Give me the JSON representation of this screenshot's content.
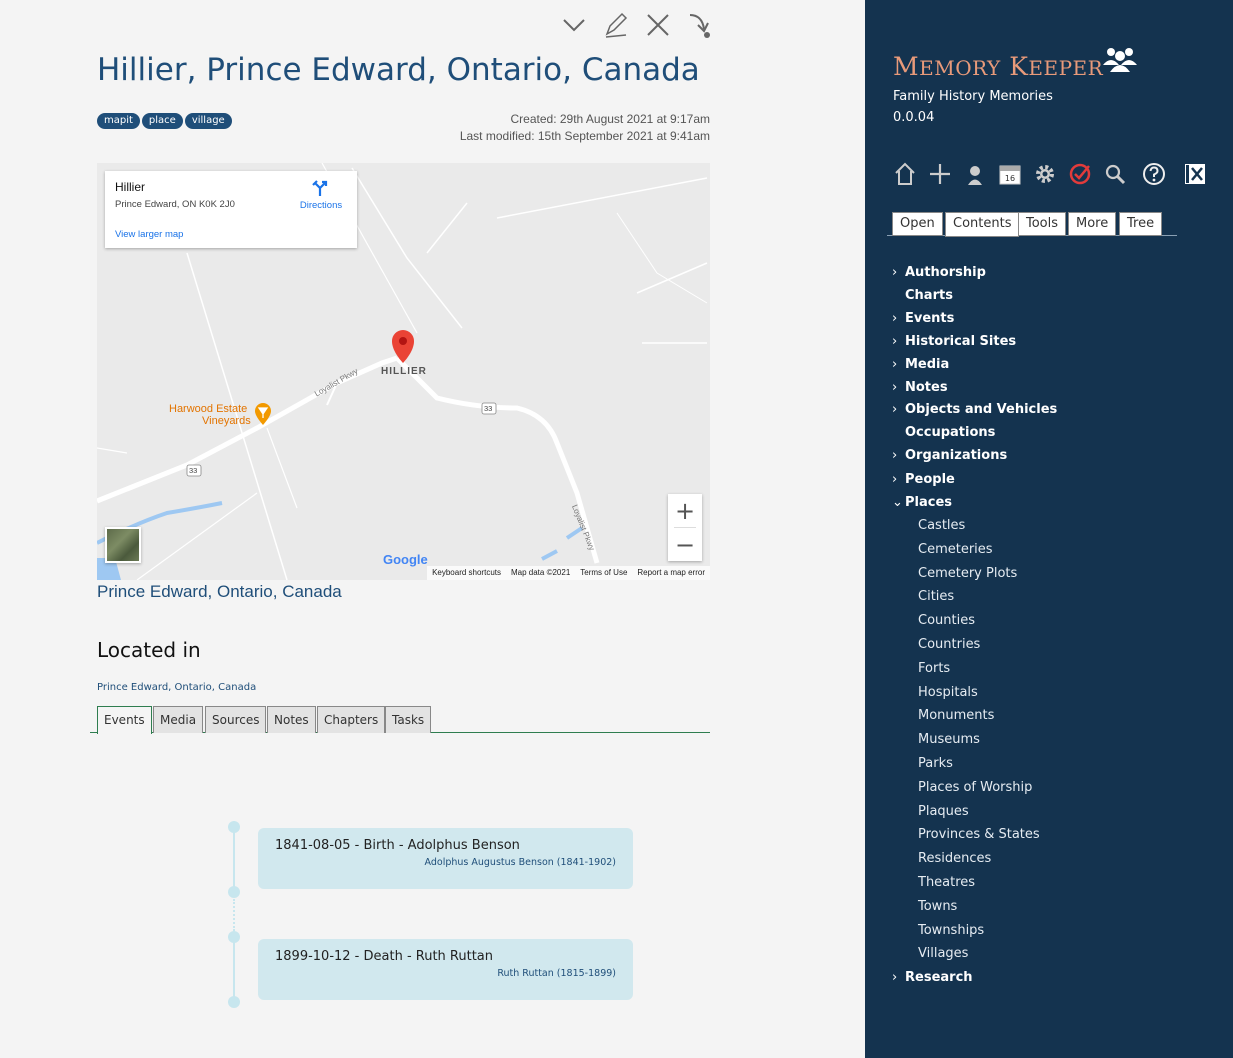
{
  "page": {
    "title": "Hillier, Prince Edward, Ontario, Canada",
    "tags": [
      "mapit",
      "place",
      "village"
    ],
    "created": "Created: 29th August 2021 at 9:17am",
    "modified": "Last modified: 15th September 2021 at 9:41am"
  },
  "toolbar": {
    "icons": [
      "chevron-down-icon",
      "edit-pencil-icon",
      "close-icon",
      "link-arrow-icon"
    ]
  },
  "map": {
    "card_name": "Hillier",
    "card_address": "Prince Edward, ON K0K 2J0",
    "directions": "Directions",
    "larger_map": "View larger map",
    "place_label": "HILLIER",
    "poi_label_1": "Harwood Estate",
    "poi_label_2": "Vineyards",
    "road_label_1": "Loyalist Pkwy",
    "road_label_2": "Loyalist Pkwy",
    "route_number": "33",
    "google": "Google",
    "zoom_in": "+",
    "zoom_out": "−",
    "footer_shortcuts": "Keyboard shortcuts",
    "footer_data": "Map data ©2021",
    "footer_terms": "Terms of Use",
    "footer_report": "Report a map error"
  },
  "map_link": "Prince Edward, Ontario, Canada",
  "located": {
    "heading": "Located in",
    "link": "Prince Edward, Ontario, Canada"
  },
  "tabs": [
    "Events",
    "Media",
    "Sources",
    "Notes",
    "Chapters",
    "Tasks"
  ],
  "events": [
    {
      "title": "1841-08-05 - Birth - Adolphus Benson",
      "person": "Adolphus Augustus Benson (1841-1902)"
    },
    {
      "title": "1899-10-12 - Death - Ruth Ruttan",
      "person": "Ruth Ruttan (1815-1899)"
    }
  ],
  "sidebar": {
    "title_first_cap": "M",
    "title_first_rest": "EMORY",
    "title_second_cap": "K",
    "title_second_rest": "EEPER",
    "subtitle": "Family History Memories",
    "version": "0.0.04",
    "icons": [
      "home-icon",
      "plus-icon",
      "person-icon",
      "calendar-icon",
      "gear-icon",
      "check-circle-icon",
      "search-icon",
      "help-icon",
      "logout-icon"
    ],
    "calendar_day": "16",
    "tabs": [
      "Open",
      "Contents",
      "Tools",
      "More",
      "Tree"
    ],
    "nav": [
      {
        "label": "Authorship",
        "chevron": "›",
        "level": "top"
      },
      {
        "label": "Charts",
        "chevron": "",
        "level": "top"
      },
      {
        "label": "Events",
        "chevron": "›",
        "level": "top"
      },
      {
        "label": "Historical Sites",
        "chevron": "›",
        "level": "top"
      },
      {
        "label": "Media",
        "chevron": "›",
        "level": "top"
      },
      {
        "label": "Notes",
        "chevron": "›",
        "level": "top"
      },
      {
        "label": "Objects and Vehicles",
        "chevron": "›",
        "level": "top"
      },
      {
        "label": "Occupations",
        "chevron": "",
        "level": "top"
      },
      {
        "label": "Organizations",
        "chevron": "›",
        "level": "top"
      },
      {
        "label": "People",
        "chevron": "›",
        "level": "top"
      },
      {
        "label": "Places",
        "chevron": "⌄",
        "level": "top"
      },
      {
        "label": "Castles",
        "level": "sub"
      },
      {
        "label": "Cemeteries",
        "level": "sub"
      },
      {
        "label": "Cemetery Plots",
        "level": "sub"
      },
      {
        "label": "Cities",
        "level": "sub"
      },
      {
        "label": "Counties",
        "level": "sub"
      },
      {
        "label": "Countries",
        "level": "sub"
      },
      {
        "label": "Forts",
        "level": "sub"
      },
      {
        "label": "Hospitals",
        "level": "sub"
      },
      {
        "label": "Monuments",
        "level": "sub"
      },
      {
        "label": "Museums",
        "level": "sub"
      },
      {
        "label": "Parks",
        "level": "sub"
      },
      {
        "label": "Places of Worship",
        "level": "sub"
      },
      {
        "label": "Plaques",
        "level": "sub"
      },
      {
        "label": "Provinces & States",
        "level": "sub"
      },
      {
        "label": "Residences",
        "level": "sub"
      },
      {
        "label": "Theatres",
        "level": "sub"
      },
      {
        "label": "Towns",
        "level": "sub"
      },
      {
        "label": "Townships",
        "level": "sub"
      },
      {
        "label": "Villages",
        "level": "sub"
      },
      {
        "label": "Research",
        "chevron": "›",
        "level": "top"
      }
    ]
  },
  "colors": {
    "sidebar_bg": "#14334f",
    "accent_title": "#e89a7a",
    "link": "#1f4e79",
    "event_bg": "#d1e8ee",
    "map_pin": "#ea4335"
  }
}
